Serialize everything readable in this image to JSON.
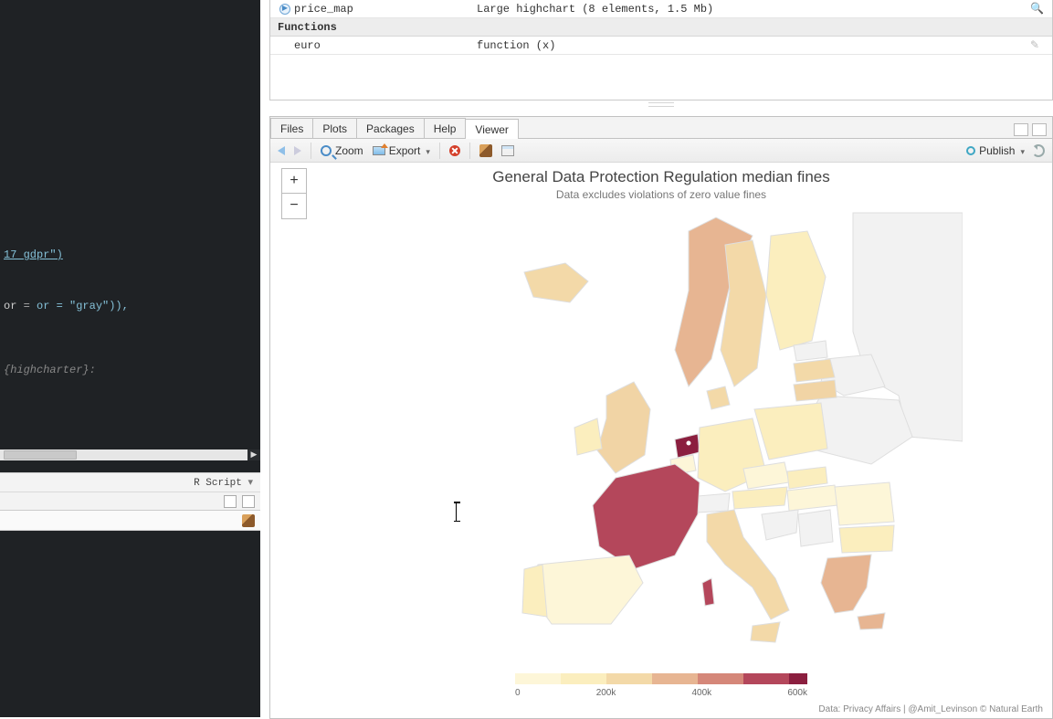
{
  "editor": {
    "code_lines": [
      "17 gdpr\")",
      "",
      "",
      "",
      "",
      "or = \"gray\")),",
      "",
      "",
      "",
      "",
      "{highcharter}:"
    ],
    "status_mode": "R Script"
  },
  "environment": {
    "rows": [
      {
        "icon": true,
        "name": "price_map",
        "value": "Large highchart (8 elements, 1.5 Mb)",
        "action": "search"
      }
    ],
    "section": "Functions",
    "fn_rows": [
      {
        "name": "euro",
        "value": "function (x)",
        "action": "edit"
      }
    ]
  },
  "tabs": {
    "items": [
      "Files",
      "Plots",
      "Packages",
      "Help",
      "Viewer"
    ],
    "active": 4
  },
  "toolbar": {
    "zoom_label": "Zoom",
    "export_label": "Export",
    "publish_label": "Publish"
  },
  "viewer": {
    "title": "General Data Protection Regulation median fines",
    "subtitle": "Data excludes violations of zero value fines",
    "credits": "Data: Privacy Affairs | @Amit_Levinson © Natural Earth",
    "zoom_plus": "+",
    "zoom_minus": "−"
  },
  "chart_data": {
    "type": "choropleth-map",
    "title": "General Data Protection Regulation median fines",
    "subtitle": "Data excludes violations of zero value fines",
    "legend": {
      "ticks": [
        "0",
        "200k",
        "400k",
        "600k"
      ],
      "colors": [
        "#fdf6d8",
        "#fbeebe",
        "#f3d9a8",
        "#e7b592",
        "#d58779",
        "#b4475b",
        "#8b1f3f"
      ]
    },
    "regions": [
      {
        "name": "France",
        "value": 600000,
        "fill": "#b4475b"
      },
      {
        "name": "Netherlands",
        "value": 600000,
        "fill": "#8b1f3f"
      },
      {
        "name": "Norway",
        "value": 220000,
        "fill": "#e7b592"
      },
      {
        "name": "Sweden",
        "value": 120000,
        "fill": "#f3d9a8"
      },
      {
        "name": "Finland",
        "value": 60000,
        "fill": "#fbeebe"
      },
      {
        "name": "Iceland",
        "value": 100000,
        "fill": "#f3d9a8"
      },
      {
        "name": "United Kingdom",
        "value": 150000,
        "fill": "#f1d4a5"
      },
      {
        "name": "Ireland",
        "value": 90000,
        "fill": "#fbeebe"
      },
      {
        "name": "Germany",
        "value": 80000,
        "fill": "#fbeebe"
      },
      {
        "name": "Belgium",
        "value": 60000,
        "fill": "#fdf6d8"
      },
      {
        "name": "Denmark",
        "value": 180000,
        "fill": "#f3d9a8"
      },
      {
        "name": "Poland",
        "value": 80000,
        "fill": "#fbeebe"
      },
      {
        "name": "Lithuania",
        "value": 150000,
        "fill": "#f1d4a5"
      },
      {
        "name": "Latvia",
        "value": 120000,
        "fill": "#f3d9a8"
      },
      {
        "name": "Estonia",
        "value": null,
        "fill": "#f2f2f2"
      },
      {
        "name": "Czechia",
        "value": 40000,
        "fill": "#fdf6d8"
      },
      {
        "name": "Austria",
        "value": 80000,
        "fill": "#fbeebe"
      },
      {
        "name": "Hungary",
        "value": 40000,
        "fill": "#fdf6d8"
      },
      {
        "name": "Slovakia",
        "value": 60000,
        "fill": "#fbeebe"
      },
      {
        "name": "Romania",
        "value": 40000,
        "fill": "#fdf6d8"
      },
      {
        "name": "Bulgaria",
        "value": 60000,
        "fill": "#fbeebe"
      },
      {
        "name": "Greece",
        "value": 220000,
        "fill": "#e7b592"
      },
      {
        "name": "Italy",
        "value": 120000,
        "fill": "#f3d9a8"
      },
      {
        "name": "Spain",
        "value": 60000,
        "fill": "#fdf6d8"
      },
      {
        "name": "Portugal",
        "value": 80000,
        "fill": "#fbeebe"
      },
      {
        "name": "Switzerland",
        "value": null,
        "fill": "#f2f2f2"
      },
      {
        "name": "Croatia",
        "value": null,
        "fill": "#f2f2f2"
      },
      {
        "name": "Serbia",
        "value": null,
        "fill": "#f2f2f2"
      },
      {
        "name": "Ukraine",
        "value": null,
        "fill": "#f2f2f2"
      },
      {
        "name": "Belarus",
        "value": null,
        "fill": "#f2f2f2"
      },
      {
        "name": "Russia",
        "value": null,
        "fill": "#f2f2f2"
      },
      {
        "name": "Corsica",
        "value": 600000,
        "fill": "#b4475b"
      }
    ]
  }
}
